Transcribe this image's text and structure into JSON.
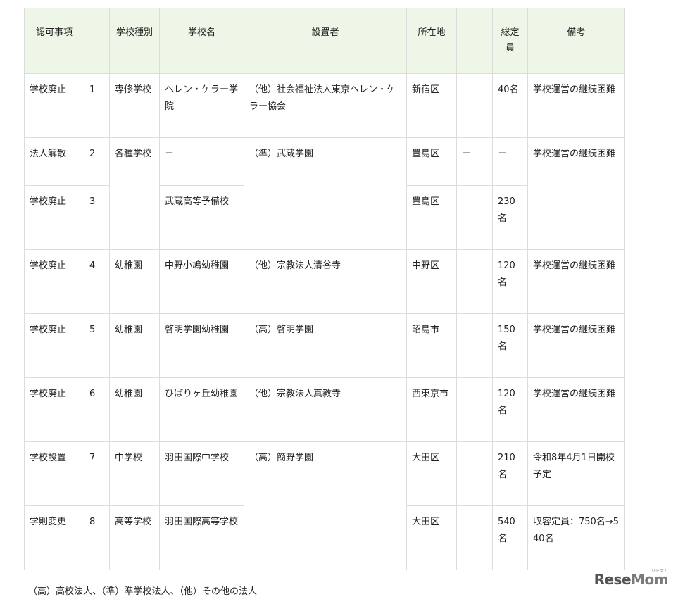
{
  "table": {
    "headers": [
      "認可事項",
      "",
      "学校種別",
      "学校名",
      "設置者",
      "所在地",
      "",
      "総定員",
      "備考"
    ],
    "rows": [
      {
        "action": "学校廃止",
        "no": "1",
        "type": "専修学校",
        "school": "ヘレン・ケラー学院",
        "founder": "（他）社会福祉法人東京ヘレン・ケラー協会",
        "location": "新宿区",
        "extra": "",
        "capacity": "40名",
        "note": "学校運営の継続困難"
      },
      {
        "action": "法人解散",
        "no": "2",
        "type": "各種学校",
        "school": "－",
        "founder": "（準）武蔵学園",
        "location": "豊島区",
        "extra": "－",
        "capacity": "－",
        "note": "学校運営の継続困難"
      },
      {
        "action": "学校廃止",
        "no": "3",
        "type": "",
        "school": "武蔵高等予備校",
        "founder": "",
        "location": "豊島区",
        "extra": "",
        "capacity": "230名",
        "note": ""
      },
      {
        "action": "学校廃止",
        "no": "4",
        "type": "幼稚園",
        "school": "中野小鳩幼稚園",
        "founder": "（他）宗教法人清谷寺",
        "location": "中野区",
        "extra": "",
        "capacity": "120名",
        "note": "学校運営の継続困難"
      },
      {
        "action": "学校廃止",
        "no": "5",
        "type": "幼稚園",
        "school": "啓明学園幼稚園",
        "founder": "（高）啓明学園",
        "location": "昭島市",
        "extra": "",
        "capacity": "150名",
        "note": "学校運営の継続困難"
      },
      {
        "action": "学校廃止",
        "no": "6",
        "type": "幼稚園",
        "school": "ひばりヶ丘幼稚園",
        "founder": "（他）宗教法人真教寺",
        "location": "西東京市",
        "extra": "",
        "capacity": "120名",
        "note": "学校運営の継続困難"
      },
      {
        "action": "学校設置",
        "no": "7",
        "type": "中学校",
        "school": "羽田国際中学校",
        "founder": "（高）簡野学園",
        "location": "大田区",
        "extra": "",
        "capacity": "210名",
        "note": "令和8年4月1日開校予定"
      },
      {
        "action": "学則変更",
        "no": "8",
        "type": "高等学校",
        "school": "羽田国際高等学校",
        "founder": "",
        "location": "大田区",
        "extra": "",
        "capacity": "540名",
        "note": "収容定員：750名→540名"
      }
    ]
  },
  "footnote": "（高）高校法人、（準）準学校法人、（他）その他の法人",
  "brand": {
    "name_a": "Rese",
    "name_b": "Mom",
    "sub": "リセマム"
  }
}
